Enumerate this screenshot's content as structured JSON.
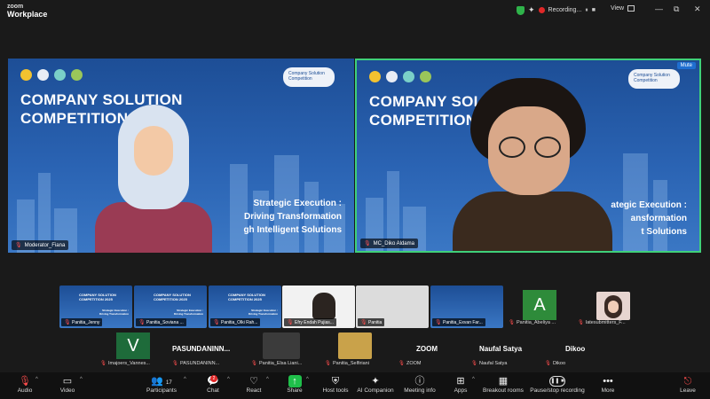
{
  "app": {
    "brand_top": "zoom",
    "brand_bottom": "Workplace"
  },
  "titlebar": {
    "recording_label": "Recording...",
    "rec_controls": "⏸ ■",
    "view_label": "View",
    "minimize": "—",
    "restore": "⧉",
    "close": "✕",
    "colors": {
      "shield": "#2fb34a",
      "rec_dot": "#e02828"
    }
  },
  "slide": {
    "title_line1": "COMPANY SOLUTION",
    "title_line2": "COMPETITION 2025",
    "title_line2_cut": "COMPETITION 202",
    "subtitle_line1": "Strategic Execution :",
    "subtitle_line2": "Driving Transformation",
    "subtitle_line3": "gh Intelligent Solutions",
    "subtitle2_line1": "ategic Execution :",
    "subtitle2_line2": "ansformation",
    "subtitle2_line3": "t Solutions",
    "logo_text": "Company Solution Competition"
  },
  "main_tiles": [
    {
      "name": "Moderator_Fiana"
    },
    {
      "name": "MC_Diko Aldama",
      "mute_button": "Mute"
    }
  ],
  "gallery_row1": [
    {
      "label": "Panitia_Jenny"
    },
    {
      "label": "Panitia_Soviana ..."
    },
    {
      "label": "Panitia_Olki Rah..."
    },
    {
      "label": "Efry Endah Pujias..."
    },
    {
      "label": "Panitia"
    },
    {
      "label": "Panitia_Exvan Far..."
    },
    {
      "label": "Panitia_Abeliya ...",
      "avatar": "A",
      "color": "#2e8b3a"
    },
    {
      "label": "latesubmitters_F..."
    }
  ],
  "gallery_row2": [
    {
      "label": "Imajoers_Vannes...",
      "avatar": "V",
      "color": "#1e6b3a"
    },
    {
      "label": "PASUNDANINN...",
      "title": "PASUNDANINN..."
    },
    {
      "label": "Panitia_Elsa Liani..."
    },
    {
      "label": "Panitia_Selfiriani"
    },
    {
      "label": "ZOOM",
      "title": "ZOOM"
    },
    {
      "label": "Naufal Satya",
      "title": "Naufal Satya"
    },
    {
      "label": "Dikoo",
      "title": "Dikoo"
    }
  ],
  "toolbar": {
    "audio": "Audio",
    "video": "Video",
    "participants": "Participants",
    "participants_count": "17",
    "chat": "Chat",
    "chat_badge": "2",
    "react": "React",
    "share": "Share",
    "host_tools": "Host tools",
    "ai_companion": "AI Companion",
    "meeting_info": "Meeting info",
    "apps": "Apps",
    "breakout_rooms": "Breakout rooms",
    "pause_stop": "Pause/stop recording",
    "more": "More",
    "leave": "Leave",
    "colors": {
      "share": "#1fbf4a",
      "danger": "#ff4d4d"
    }
  }
}
